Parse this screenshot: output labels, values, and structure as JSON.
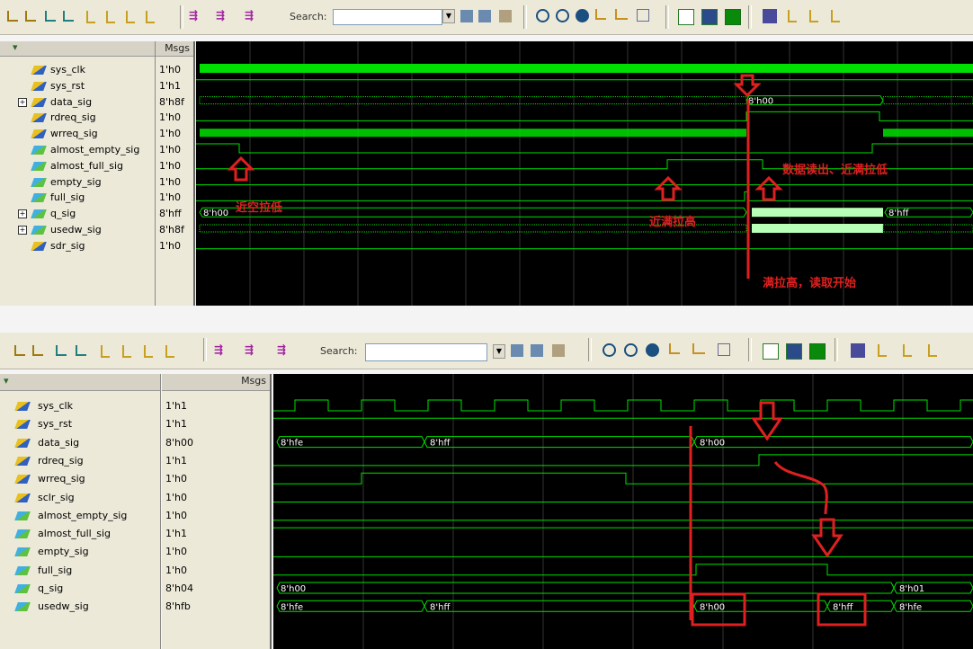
{
  "panel_top": {
    "toolbar": {
      "search_label": "Search:",
      "search_value": ""
    },
    "names_header": {
      "menu_label": "▾",
      "msgs_label": "Msgs"
    },
    "signals": [
      {
        "name": "sys_clk",
        "value": "1'h0",
        "kind": "in",
        "expandable": false
      },
      {
        "name": "sys_rst",
        "value": "1'h1",
        "kind": "in",
        "expandable": false
      },
      {
        "name": "data_sig",
        "value": "8'h8f",
        "kind": "in",
        "expandable": true
      },
      {
        "name": "rdreq_sig",
        "value": "1'h0",
        "kind": "in",
        "expandable": false
      },
      {
        "name": "wrreq_sig",
        "value": "1'h0",
        "kind": "in",
        "expandable": false
      },
      {
        "name": "almost_empty_sig",
        "value": "1'h0",
        "kind": "out",
        "expandable": false
      },
      {
        "name": "almost_full_sig",
        "value": "1'h0",
        "kind": "out",
        "expandable": false
      },
      {
        "name": "empty_sig",
        "value": "1'h0",
        "kind": "out",
        "expandable": false
      },
      {
        "name": "full_sig",
        "value": "1'h0",
        "kind": "out",
        "expandable": false
      },
      {
        "name": "q_sig",
        "value": "8'hff",
        "kind": "out",
        "expandable": true
      },
      {
        "name": "usedw_sig",
        "value": "8'h8f",
        "kind": "out",
        "expandable": true
      },
      {
        "name": "sdr_sig",
        "value": "1'h0",
        "kind": "in",
        "expandable": false
      }
    ],
    "wave_labels": {
      "data_mid": "8'h00",
      "q_start": "8'h00",
      "q_end": "8'hff"
    },
    "annotations": {
      "almost_empty_low": "近空拉低",
      "almost_full_high": "近满拉高",
      "read_out_low": "数据读出、近满拉低",
      "full_high_read_start": "满拉高，读取开始"
    }
  },
  "panel_bottom": {
    "toolbar": {
      "search_label": "Search:",
      "search_value": ""
    },
    "names_header": {
      "menu_label": "▾",
      "msgs_label": "Msgs"
    },
    "signals": [
      {
        "name": "sys_clk",
        "value": "1'h1",
        "kind": "in",
        "expandable": false
      },
      {
        "name": "sys_rst",
        "value": "1'h1",
        "kind": "in",
        "expandable": false
      },
      {
        "name": "data_sig",
        "value": "8'h00",
        "kind": "in",
        "expandable": false
      },
      {
        "name": "rdreq_sig",
        "value": "1'h1",
        "kind": "in",
        "expandable": false
      },
      {
        "name": "wrreq_sig",
        "value": "1'h0",
        "kind": "in",
        "expandable": false
      },
      {
        "name": "sclr_sig",
        "value": "1'h0",
        "kind": "in",
        "expandable": false
      },
      {
        "name": "almost_empty_sig",
        "value": "1'h0",
        "kind": "out",
        "expandable": false
      },
      {
        "name": "almost_full_sig",
        "value": "1'h1",
        "kind": "out",
        "expandable": false
      },
      {
        "name": "empty_sig",
        "value": "1'h0",
        "kind": "out",
        "expandable": false
      },
      {
        "name": "full_sig",
        "value": "1'h0",
        "kind": "out",
        "expandable": false
      },
      {
        "name": "q_sig",
        "value": "8'h04",
        "kind": "out",
        "expandable": false
      },
      {
        "name": "usedw_sig",
        "value": "8'hfb",
        "kind": "out",
        "expandable": false
      }
    ],
    "wave_labels": {
      "data_a": "8'hfe",
      "data_b": "8'hff",
      "data_c": "8'h00",
      "q_a": "8'h00",
      "q_b": "8'h01",
      "usedw_a": "8'hfe",
      "usedw_b": "8'hff",
      "usedw_c": "8'h00",
      "usedw_d": "8'hff",
      "usedw_e": "8'hfe"
    }
  },
  "colors": {
    "wave_green": "#00e000",
    "wave_bg": "#000000",
    "annotation_red": "#e02020",
    "bus_light": "#b8ffb8"
  }
}
